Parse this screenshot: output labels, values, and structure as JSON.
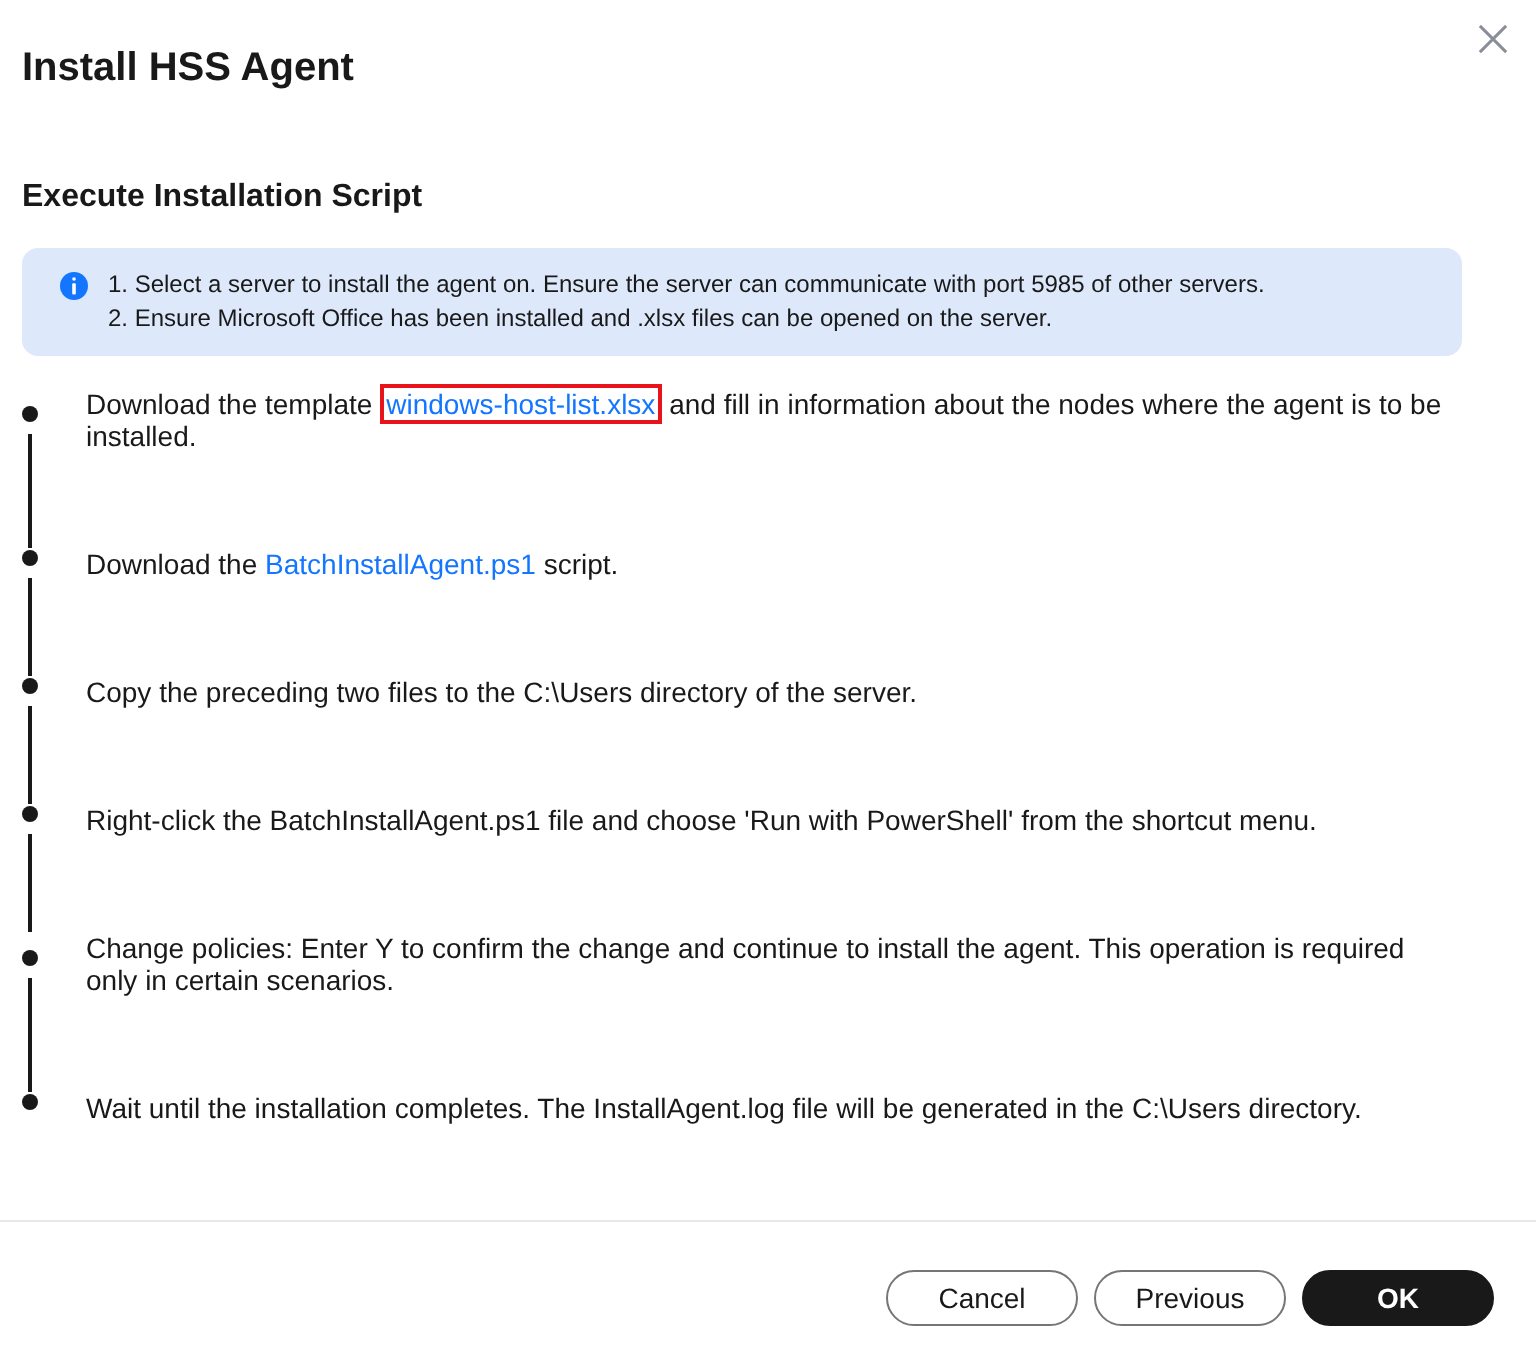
{
  "dialog": {
    "title": "Install HSS Agent"
  },
  "section": {
    "heading": "Execute Installation Script"
  },
  "info": {
    "notes": [
      "1. Select a server to install the agent on. Ensure the server can communicate with port 5985 of other servers.",
      "2. Ensure Microsoft Office has been installed and .xlsx files can be opened on the server."
    ]
  },
  "steps": [
    {
      "parts": [
        {
          "kind": "text",
          "text": "Download the template "
        },
        {
          "kind": "link",
          "text": "windows-host-list.xlsx",
          "highlighted": true
        },
        {
          "kind": "text",
          "text": " and fill in information about the nodes where the agent is to be installed."
        }
      ]
    },
    {
      "parts": [
        {
          "kind": "text",
          "text": "Download the "
        },
        {
          "kind": "link",
          "text": "BatchInstallAgent.ps1",
          "highlighted": false
        },
        {
          "kind": "text",
          "text": " script."
        }
      ]
    },
    {
      "parts": [
        {
          "kind": "text",
          "text": "Copy the preceding two files to the C:\\Users directory of the server."
        }
      ]
    },
    {
      "parts": [
        {
          "kind": "text",
          "text": "Right-click the BatchInstallAgent.ps1 file and choose 'Run with PowerShell' from the shortcut menu."
        }
      ]
    },
    {
      "parts": [
        {
          "kind": "text",
          "text": "Change policies: Enter Y to confirm the change and continue to install the agent. This operation is required only in certain scenarios."
        }
      ]
    },
    {
      "parts": [
        {
          "kind": "text",
          "text": "Wait until the installation completes. The InstallAgent.log file will be generated in the C:\\Users directory."
        }
      ]
    }
  ],
  "buttons": [
    {
      "label": "Cancel",
      "kind": "secondary"
    },
    {
      "label": "Previous",
      "kind": "secondary"
    },
    {
      "label": "OK",
      "kind": "primary"
    }
  ]
}
